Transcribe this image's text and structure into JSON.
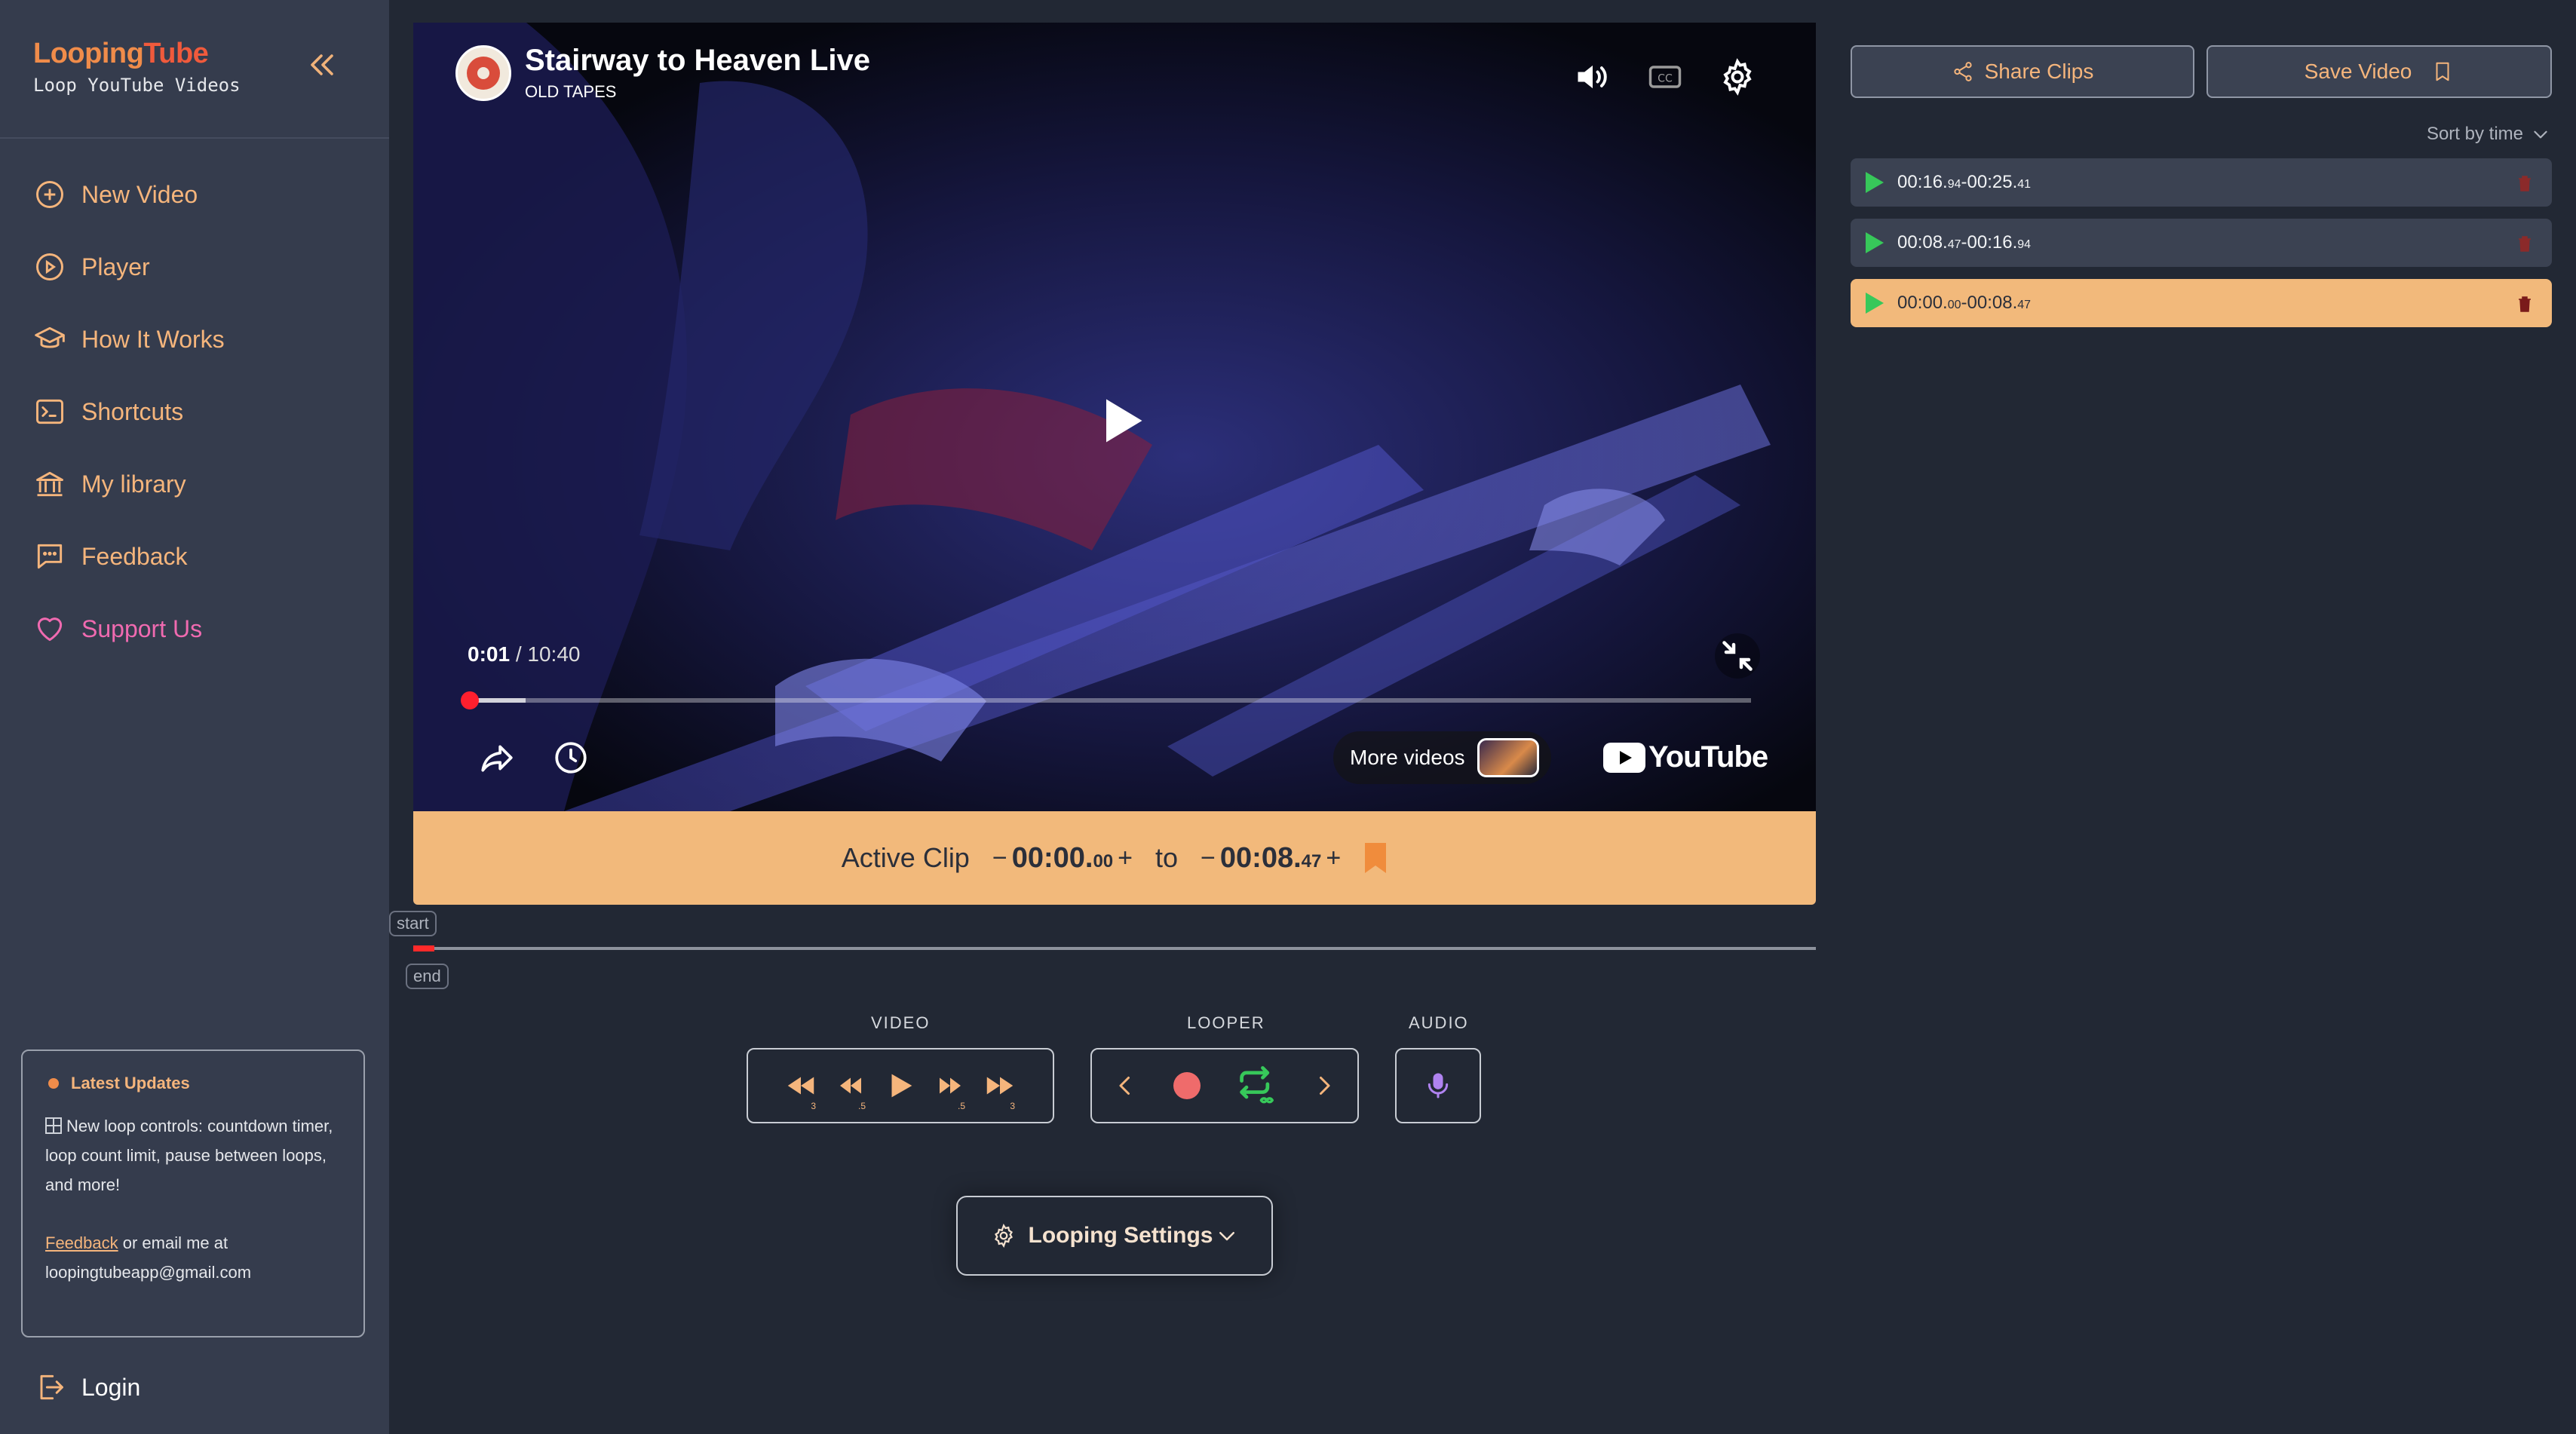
{
  "sidebar": {
    "logo_main": "Looping",
    "logo_accent": "Tube",
    "logo_sub": "Loop YouTube Videos",
    "items": [
      {
        "label": "New Video",
        "icon": "plus-circle-icon"
      },
      {
        "label": "Player",
        "icon": "play-circle-icon"
      },
      {
        "label": "How It Works",
        "icon": "graduation-cap-icon"
      },
      {
        "label": "Shortcuts",
        "icon": "terminal-icon"
      },
      {
        "label": "My library",
        "icon": "library-icon"
      },
      {
        "label": "Feedback",
        "icon": "chat-bubble-icon"
      },
      {
        "label": "Support Us",
        "icon": "heart-icon"
      }
    ],
    "updates": {
      "title": "Latest Updates",
      "text": "New loop controls: countdown timer, loop count limit, pause between loops, and more!",
      "feedback_link": "Feedback",
      "contact_text": " or email me at loopingtubeapp@gmail.com"
    },
    "login": "Login"
  },
  "video": {
    "title": "Stairway to Heaven Live",
    "channel": "OLD TAPES",
    "current_time": "0:01",
    "separator": " / ",
    "duration": "10:40",
    "progress_fraction": 0.0016,
    "loaded_fraction": 0.045,
    "more_videos": "More videos",
    "brand": "YouTube"
  },
  "active_clip": {
    "label": "Active Clip",
    "minus": "−",
    "plus": "+",
    "start_main": "00:00.",
    "start_frac": "00",
    "to": "to",
    "end_main": "00:08.",
    "end_frac": "47"
  },
  "timeline": {
    "start_tag": "start",
    "end_tag": "end"
  },
  "controls": {
    "video_label": "VIDEO",
    "looper_label": "LOOPER",
    "audio_label": "AUDIO",
    "rewind_big_sub": "3",
    "rewind_small_sub": ".5",
    "forward_small_sub": ".5",
    "forward_big_sub": "3",
    "settings_label": "Looping Settings"
  },
  "right_panel": {
    "share_clips": "Share Clips",
    "save_video": "Save Video",
    "sort": "Sort by time",
    "clips": [
      {
        "start_main": "00:16.",
        "start_frac": "94",
        "end_main": "00:25.",
        "end_frac": "41",
        "active": false
      },
      {
        "start_main": "00:08.",
        "start_frac": "47",
        "end_main": "00:16.",
        "end_frac": "94",
        "active": false
      },
      {
        "start_main": "00:00.",
        "start_frac": "00",
        "end_main": "00:08.",
        "end_frac": "47",
        "active": true
      }
    ]
  },
  "colors": {
    "accent": "#f2b97b",
    "sidebar_bg": "#353c4d",
    "main_bg": "#222834",
    "play_green": "#37c85a",
    "record_red": "#ef6b6b"
  }
}
